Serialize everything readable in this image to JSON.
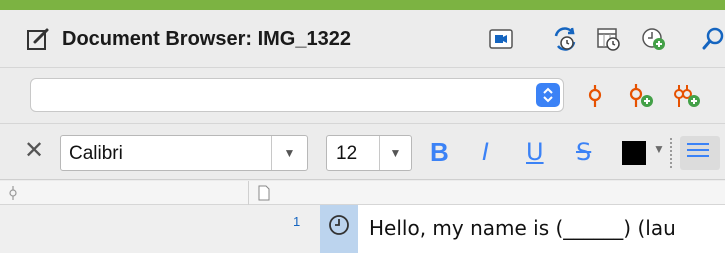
{
  "window": {
    "title": "Document Browser: IMG_1322",
    "accent_color": "#7cb342"
  },
  "toolbar_icons": [
    "edit-icon",
    "video-icon",
    "sync-history-icon",
    "calendar-history-icon",
    "add-timestamp-icon",
    "search-icon"
  ],
  "code_bar": {
    "selected_code": "",
    "code_icons": [
      "code-icon",
      "add-code-icon",
      "add-multiple-codes-icon"
    ]
  },
  "format_bar": {
    "font_family": "Calibri",
    "font_size": "12",
    "bold": "B",
    "italic": "I",
    "underline": "U",
    "strike": "S",
    "text_color": "#000000"
  },
  "columns": [
    "code-column-icon",
    "document-column-icon"
  ],
  "document": {
    "lines": [
      {
        "number": "1",
        "text": "Hello, my name is (______) (lau"
      }
    ]
  }
}
